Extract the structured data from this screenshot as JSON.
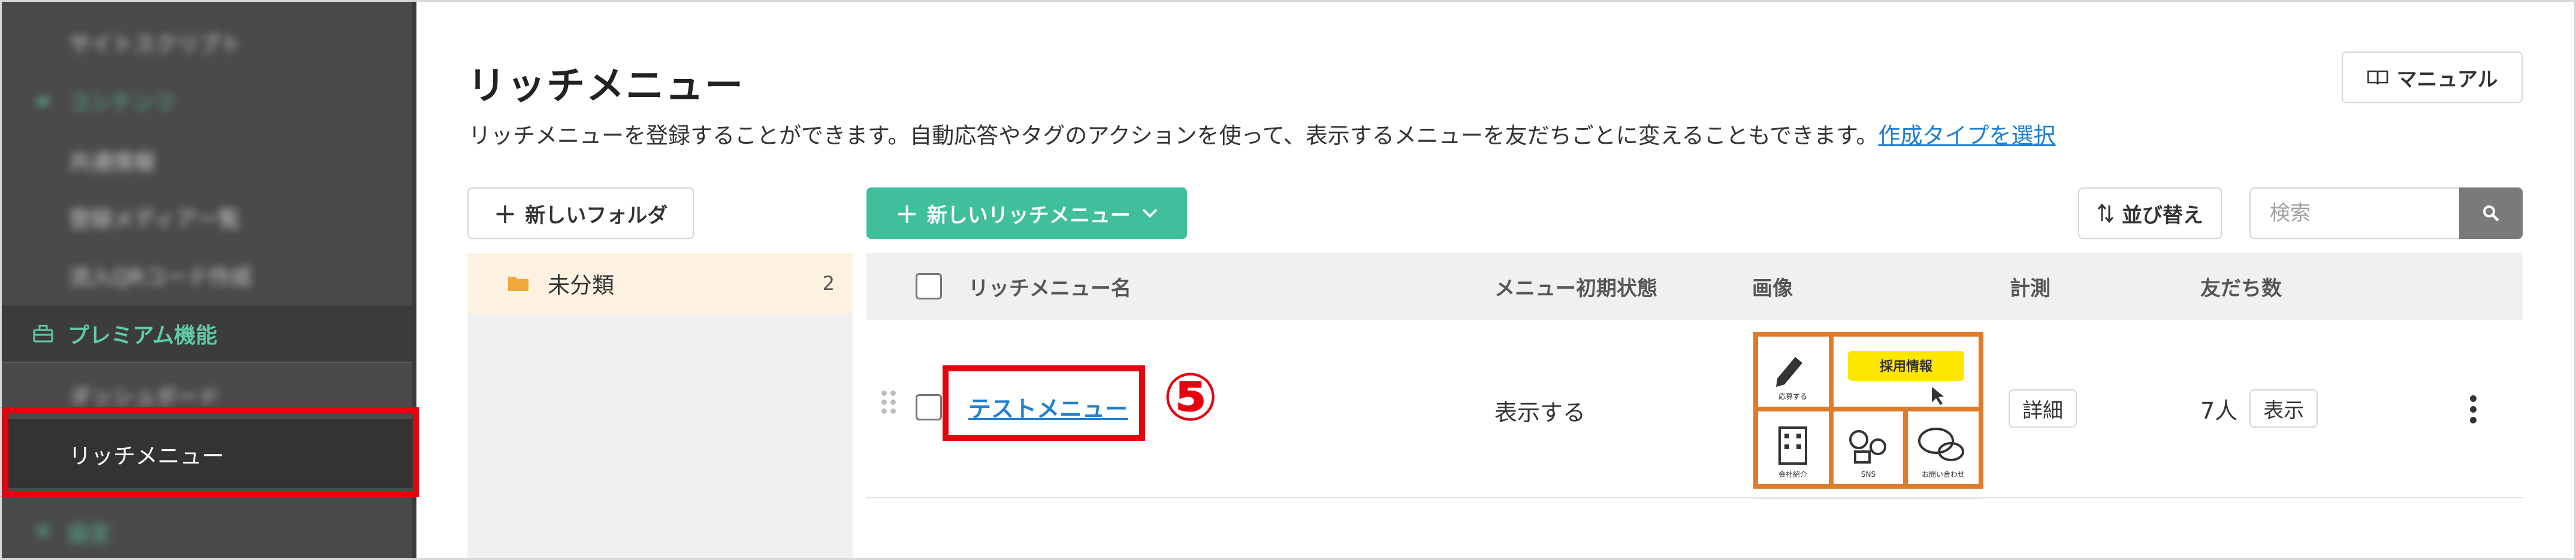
{
  "sidebar": {
    "items": [
      {
        "label": "サイトスクリプト",
        "blurred": true
      },
      {
        "label": "コンテンツ",
        "blurred": true,
        "icon": "folder-icon"
      },
      {
        "label": "共通情報",
        "blurred": true
      },
      {
        "label": "登録メディア一覧",
        "blurred": true
      },
      {
        "label": "流入QRコード作成",
        "blurred": true
      },
      {
        "label": "プレミアム機能",
        "blurred": false,
        "icon": "premium-box-icon"
      },
      {
        "label": "ダッシュボード",
        "blurred": true
      },
      {
        "label": "リッチメニュー",
        "blurred": false,
        "active": true
      },
      {
        "label": "設定",
        "blurred": true,
        "icon": "gear-icon"
      }
    ]
  },
  "header": {
    "title": "リッチメニュー",
    "description": "リッチメニューを登録することができます。自動応答やタグのアクションを使って、表示するメニューを友だちごとに変えることもできます。",
    "link_label": "作成タイプを選択",
    "manual_label": "マニュアル"
  },
  "toolbar": {
    "new_folder_label": "新しいフォルダ",
    "new_menu_label": "新しいリッチメニュー",
    "sort_label": "並び替え",
    "search_placeholder": "検索"
  },
  "folders": [
    {
      "name": "未分類",
      "count": "2"
    }
  ],
  "table": {
    "columns": [
      "リッチメニュー名",
      "メニュー初期状態",
      "画像",
      "計測",
      "友だち数"
    ],
    "rows": [
      {
        "name": "テストメニュー",
        "initial_state": "表示する",
        "measure_label": "詳細",
        "friends": "7人",
        "show_label": "表示"
      }
    ]
  },
  "annotation": {
    "step_marker": "⑤"
  },
  "thumbnail": {
    "banner_text": "採用情報",
    "labels": [
      "応募する",
      "会社紹介",
      "SNS",
      "お問い合わせ"
    ]
  },
  "colors": {
    "accent_green": "#3fbf9b",
    "sidebar_bg": "#4a4a4a",
    "highlight_red": "#e8000f",
    "link_blue": "#1f7fd0",
    "thumb_orange": "#e07b2a",
    "thumb_yellow": "#ffe600"
  }
}
